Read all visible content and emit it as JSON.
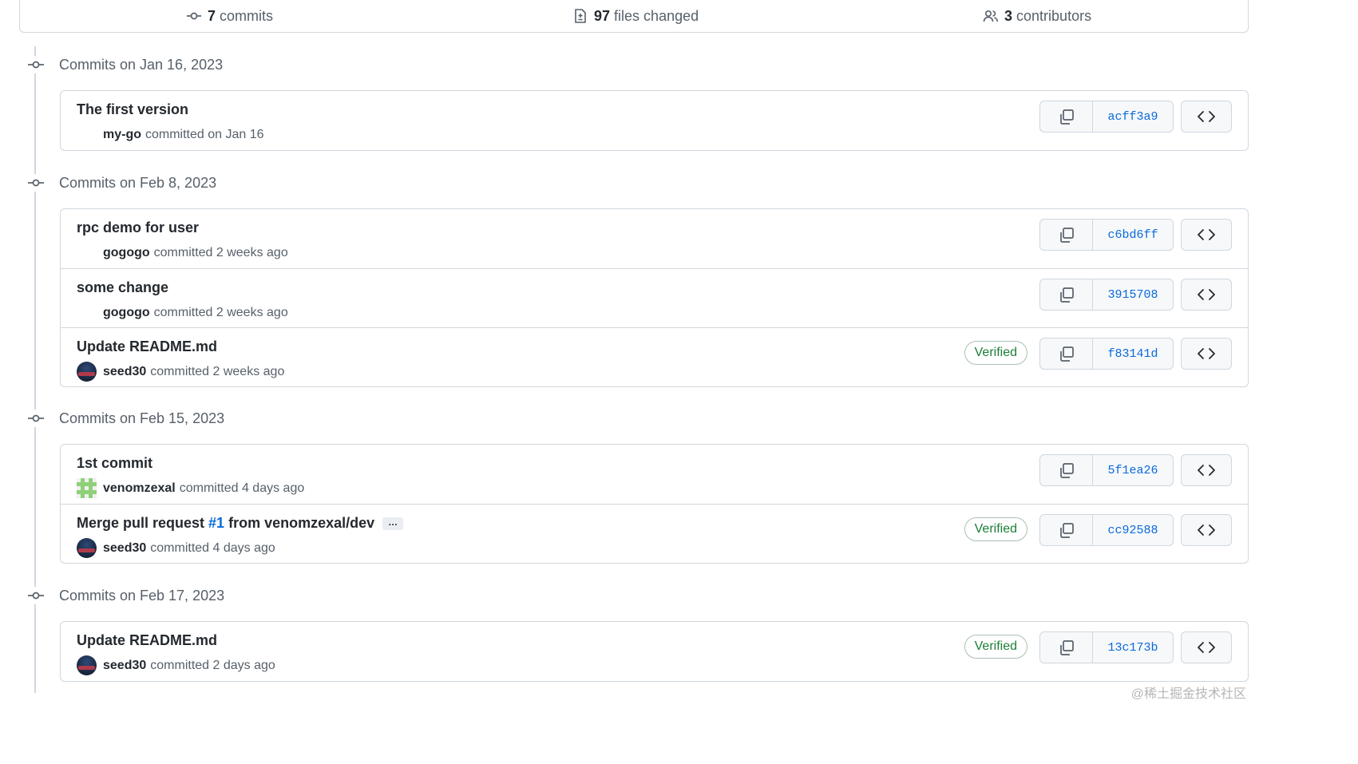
{
  "summary": {
    "commits_count": "7",
    "commits_label": "commits",
    "files_count": "97",
    "files_label": "files changed",
    "contributors_count": "3",
    "contributors_label": "contributors"
  },
  "verified_label": "Verified",
  "groups": [
    {
      "title": "Commits on Jan 16, 2023",
      "commits": [
        {
          "message": "The first version",
          "author": "my-go",
          "when": "committed on Jan 16",
          "sha": "acff3a9",
          "verified": false
        }
      ]
    },
    {
      "title": "Commits on Feb 8, 2023",
      "commits": [
        {
          "message": "rpc demo for user",
          "author": "gogogo",
          "when": "committed 2 weeks ago",
          "sha": "c6bd6ff",
          "verified": false
        },
        {
          "message": "some change",
          "author": "gogogo",
          "when": "committed 2 weeks ago",
          "sha": "3915708",
          "verified": false
        },
        {
          "message": "Update README.md",
          "author": "seed30",
          "when": "committed 2 weeks ago",
          "sha": "f83141d",
          "verified": true
        }
      ]
    },
    {
      "title": "Commits on Feb 15, 2023",
      "commits": [
        {
          "message": "1st commit",
          "author": "venomzexal",
          "when": "committed 4 days ago",
          "sha": "5f1ea26",
          "verified": false
        },
        {
          "message_prefix": "Merge pull request ",
          "pr_number": "#1",
          "message_suffix": " from venomzexal/dev",
          "ellipsis": "…",
          "author": "seed30",
          "when": "committed 4 days ago",
          "sha": "cc92588",
          "verified": true
        }
      ]
    },
    {
      "title": "Commits on Feb 17, 2023",
      "commits": [
        {
          "message": "Update README.md",
          "author": "seed30",
          "when": "committed 2 days ago",
          "sha": "13c173b",
          "verified": true
        }
      ]
    }
  ],
  "watermark": "@稀土掘金技术社区"
}
